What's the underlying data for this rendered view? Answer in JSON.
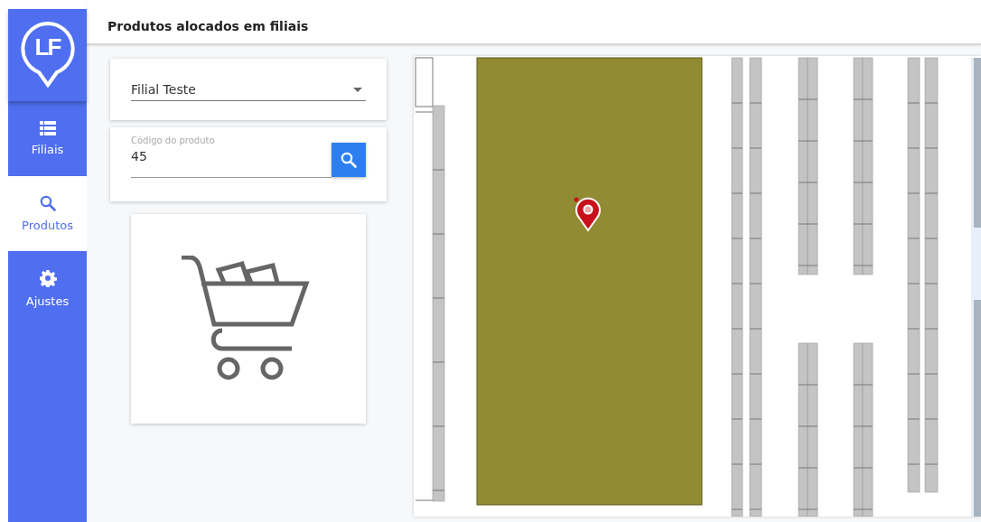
{
  "sidebar": {
    "logo": "LF",
    "items": [
      {
        "label": "Filiais",
        "kind": "list",
        "selected": false
      },
      {
        "label": "Produtos",
        "kind": "search",
        "selected": true
      },
      {
        "label": "Ajustes",
        "kind": "gear",
        "selected": false
      }
    ]
  },
  "header": {
    "title": "Produtos alocados em filiais"
  },
  "branch_select": {
    "value": "Filial Teste"
  },
  "product_search": {
    "label": "Código do produto",
    "value": "45"
  }
}
